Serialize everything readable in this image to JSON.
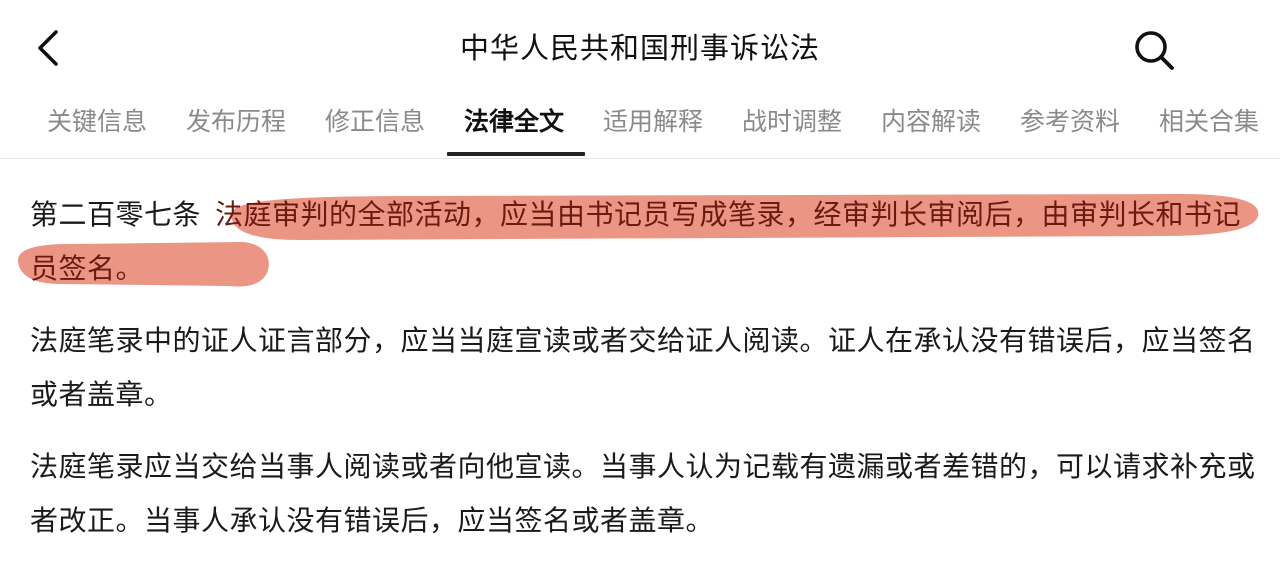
{
  "header": {
    "title": "中华人民共和国刑事诉讼法",
    "back_icon": "chevron-left-icon",
    "search_icon": "search-icon"
  },
  "tabs": [
    {
      "label": "关键信息",
      "active": false
    },
    {
      "label": "发布历程",
      "active": false
    },
    {
      "label": "修正信息",
      "active": false
    },
    {
      "label": "法律全文",
      "active": true
    },
    {
      "label": "适用解释",
      "active": false
    },
    {
      "label": "战时调整",
      "active": false
    },
    {
      "label": "内容解读",
      "active": false
    },
    {
      "label": "参考资料",
      "active": false
    },
    {
      "label": "相关合集",
      "active": false
    }
  ],
  "article": {
    "number": "第二百零七条",
    "paragraph1": "法庭审判的全部活动，应当由书记员写成笔录，经审判长审阅后，由审判长和书记员签名。",
    "paragraph2": "法庭笔录中的证人证言部分，应当当庭宣读或者交给证人阅读。证人在承认没有错误后，应当签名或者盖章。",
    "paragraph3": "法庭笔录应当交给当事人阅读或者向他宣读。当事人认为记载有遗漏或者差错的，可以请求补充或者改正。当事人承认没有错误后，应当签名或者盖章。"
  },
  "colors": {
    "highlight": "#e8826f",
    "active_tab": "#111111",
    "inactive_tab": "#8a8a8a"
  }
}
